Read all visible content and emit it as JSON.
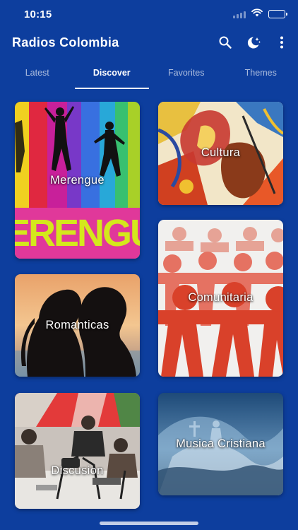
{
  "status": {
    "time": "10:15"
  },
  "app": {
    "title": "Radios Colombia"
  },
  "actions": {
    "search_icon": "search-icon",
    "theme_icon": "moon-stars-icon",
    "menu_icon": "more-vertical-icon"
  },
  "tabs": [
    {
      "label": "Latest",
      "active": false
    },
    {
      "label": "Discover",
      "active": true
    },
    {
      "label": "Favorites",
      "active": false
    },
    {
      "label": "Themes",
      "active": false
    }
  ],
  "categories": {
    "merengue": "Merengue",
    "cultura": "Cultura",
    "romanticas": "Romanticas",
    "comunitaria": "Comunitaria",
    "discusion": "Discusion",
    "cristiana": "Musica Cristiana"
  },
  "image_text": {
    "merengue_banner": "MERENGUE"
  },
  "colors": {
    "background": "#0d3e9e",
    "accent": "#ffffff"
  }
}
